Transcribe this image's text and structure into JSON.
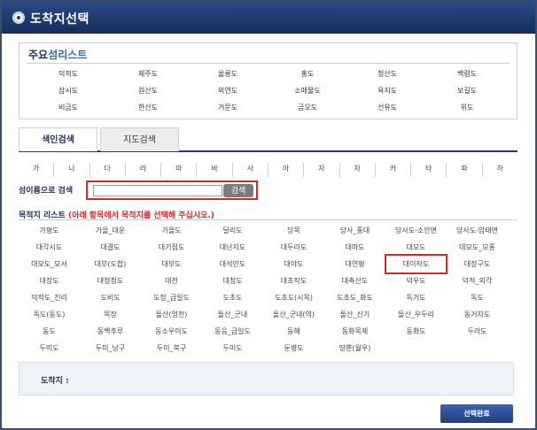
{
  "window": {
    "title": "도착지선택"
  },
  "island_list": {
    "heading_prefix": "주요",
    "heading_suffix": "섬리스트",
    "rows": [
      [
        "덕적도",
        "제주도",
        "울릉도",
        "홍도",
        "청산도",
        "백령도"
      ],
      [
        "삽시도",
        "원산도",
        "외연도",
        "소매물도",
        "욕지도",
        "보길도"
      ],
      [
        "비금도",
        "한산도",
        "거문도",
        "금오도",
        "선유도",
        "위도"
      ]
    ]
  },
  "tabs": {
    "index": "색인검색",
    "map": "지도검색"
  },
  "consonants": [
    "가",
    "나",
    "다",
    "라",
    "마",
    "바",
    "사",
    "아",
    "자",
    "차",
    "카",
    "타",
    "파",
    "하"
  ],
  "search": {
    "label": "섬이름으로 검색",
    "placeholder": "",
    "value": "",
    "button": "검색"
  },
  "destination": {
    "heading": "목적지 리스트",
    "hint": "(아래 항목에서 목적지를 선택해 주십시오.)",
    "highlighted": "대이작도",
    "rows": [
      [
        "가평도",
        "가을_대운",
        "가을도",
        "달리도",
        "당목",
        "당사_통대",
        "당사도-소안면",
        "당사도-암태면"
      ],
      [
        "대각시도",
        "대결도",
        "대기점도",
        "대난지도",
        "대두라도",
        "대마도",
        "대모도",
        "대모도_모롱"
      ],
      [
        "대모도_모서",
        "대부(도합)",
        "대부도",
        "대석만도",
        "대야도",
        "대연평",
        "대이작도",
        "대장구도"
      ],
      [
        "대장도",
        "대청청도",
        "대천",
        "대청도",
        "대초작도",
        "대촉산도",
        "덕우도",
        "덕적_외각"
      ],
      [
        "덕적도_진리",
        "도비도",
        "도장_금일도",
        "도초도",
        "도초도(시목)",
        "도초도_화도",
        "독거도",
        "독도"
      ],
      [
        "독도(동도)",
        "목장",
        "돌산(엉천)",
        "돌산_군내",
        "돌산_군내(역)",
        "돌산_신기",
        "돌산_우두리",
        "동거차도"
      ],
      [
        "동도",
        "동백추루",
        "동소우이도",
        "동음_금일도",
        "동해",
        "동화목제",
        "동화도",
        "두라도"
      ],
      [
        "두미도",
        "두미_남구",
        "두미_북구",
        "두미도",
        "둔병도",
        "땅뿐(월우)"
      ]
    ]
  },
  "arrival": {
    "label": "도착지 :"
  },
  "done_button": "선택완료",
  "colors": {
    "titlebar": "#1f3a6b",
    "accent_red": "#d12b2b",
    "heading_blue": "#2f6fb8"
  }
}
